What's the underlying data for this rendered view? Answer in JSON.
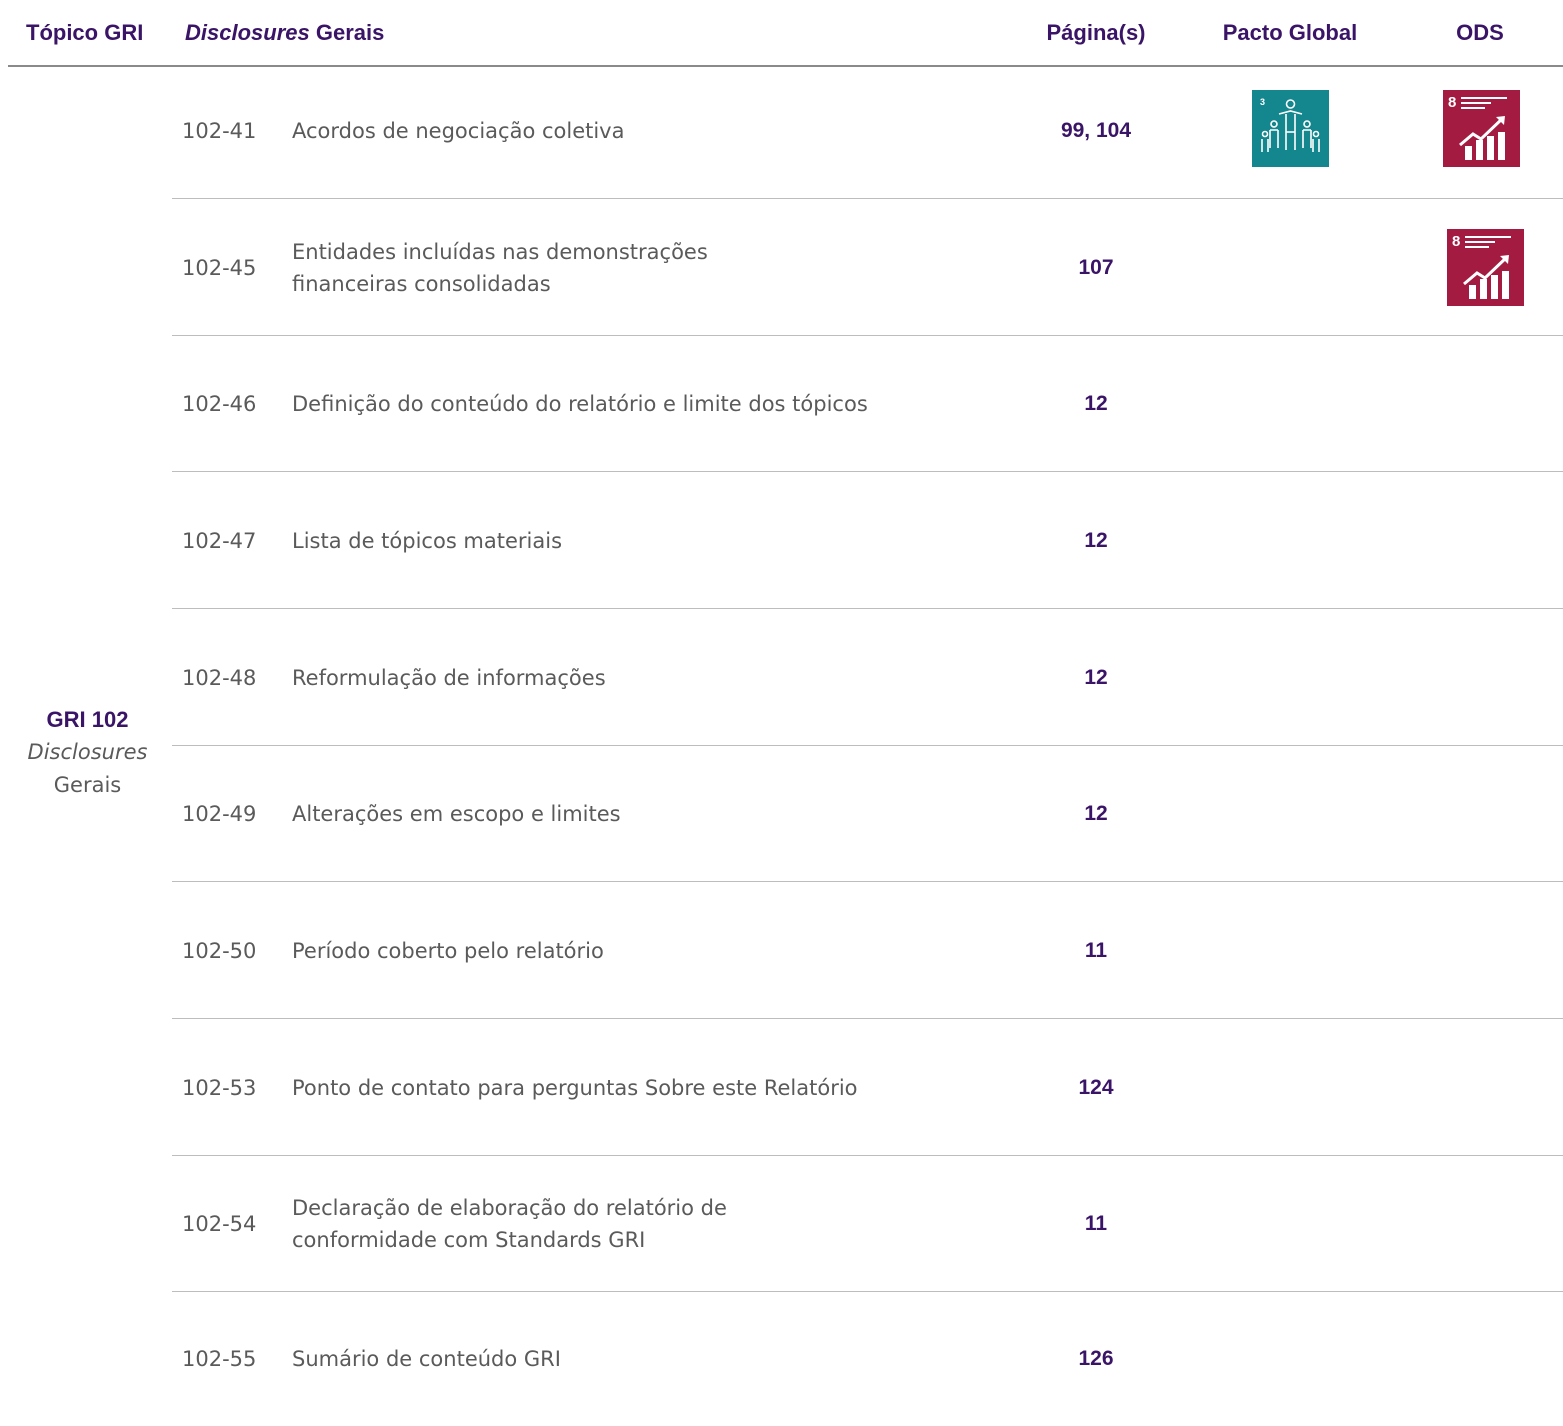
{
  "header": {
    "col_topic": "Tópico GRI",
    "col_disclosure_em": "Disclosures",
    "col_disclosure_rest": "Gerais",
    "col_pages": "Página(s)",
    "col_global_compact": "Pacto Global",
    "col_sdg": "ODS"
  },
  "topic": {
    "code": "GRI 102",
    "name_em": "Disclosures",
    "name_rest": "Gerais"
  },
  "rows": [
    {
      "code": "102-41",
      "desc": "Acordos de negociação coletiva",
      "pages": "99, 104",
      "global_compact": "3",
      "sdg": "8"
    },
    {
      "code": "102-45",
      "desc": "Entidades incluídas nas demonstrações\nfinanceiras consolidadas",
      "pages": "107",
      "sdg": "8"
    },
    {
      "code": "102-46",
      "desc": "Definição do conteúdo do relatório e limite dos tópicos",
      "pages": "12"
    },
    {
      "code": "102-47",
      "desc": "Lista de tópicos materiais",
      "pages": "12"
    },
    {
      "code": "102-48",
      "desc": "Reformulação de informações",
      "pages": "12"
    },
    {
      "code": "102-49",
      "desc": "Alterações em escopo e limites",
      "pages": "12"
    },
    {
      "code": "102-50",
      "desc": "Período coberto pelo relatório",
      "pages": "11"
    },
    {
      "code": "102-53",
      "desc": "Ponto de contato para perguntas Sobre este Relatório",
      "pages": "124"
    },
    {
      "code": "102-54",
      "desc": "Declaração de elaboração do relatório de\nconformidade com Standards GRI",
      "pages": "11"
    },
    {
      "code": "102-55",
      "desc": "Sumário de conteúdo GRI",
      "pages": "126"
    }
  ],
  "icons": {
    "global_compact_icon": "people-icon",
    "sdg_icon": "growth-chart-icon",
    "sdg_caption": "TRABALHO DECENTE E CRESCIMENTO ECONÔMICO",
    "colors": {
      "global_compact": "#13868e",
      "sdg8": "#a31b40",
      "header_text": "#3a1466"
    }
  }
}
